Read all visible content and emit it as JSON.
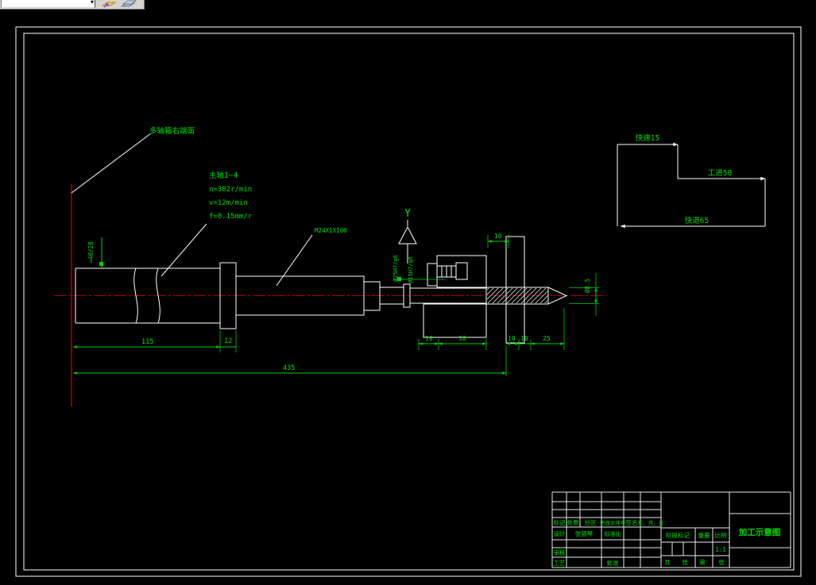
{
  "toolbar": {
    "dropdown_value": "",
    "dropdown_caret": "▾",
    "icons": [
      "make-object-layer-current-icon",
      "layer-states-icon"
    ]
  },
  "drawing": {
    "labels": {
      "face": "多轴箱右端面",
      "spindle_line1": "主轴1~4",
      "spindle_line2": "n=382r/min",
      "spindle_line3": "v=12m/min",
      "spindle_line4": "f=0.15mm/r",
      "thread": "M24X1X100",
      "section_letter": "Y"
    },
    "cycle": {
      "rapid_advance": "快速15",
      "work_feed": "工进50",
      "rapid_return": "快退65"
    },
    "dims": {
      "d115": "115",
      "d12": "12",
      "d435": "435",
      "d10_a": "10",
      "d38": "38",
      "d10_b": "10",
      "d10_c": "10",
      "d25": "25",
      "d10_top": "10",
      "left_bore": "≈40/28",
      "fit_left": "Ø25H7/g6",
      "fit_right": "Ø15H7/g6",
      "drill_dia": "Ø8.5"
    },
    "colors": {
      "annotation_green": "#00e000",
      "hatch_cyan": "#00cccc",
      "centerline_red": "#aa0000",
      "datum_red": "#e60000",
      "geometry_white": "#ffffff"
    }
  },
  "title_block": {
    "revision_headers": [
      "标记",
      "处数",
      "分区",
      "更改文件号",
      "签名",
      "年、月、日"
    ],
    "design_label": "设计",
    "designer_name": "张银琴",
    "standardization_label": "标准化",
    "check_label": "审核",
    "process_label": "工艺",
    "approve_label": "批准",
    "stage_mark_label": "阶段标记",
    "weight_label": "重量",
    "scale_label": "比例",
    "scale_value": "1:1",
    "sheet_total_label": "共",
    "sheet_unit1_label": "张",
    "sheet_no_label": "第",
    "sheet_unit2_label": "张",
    "drawing_title": "加工示意图"
  }
}
